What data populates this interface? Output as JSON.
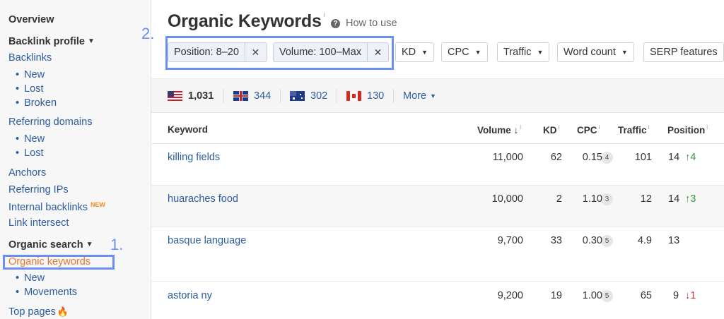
{
  "sidebar": {
    "overview": "Overview",
    "backlink_profile": "Backlink profile",
    "backlinks": "Backlinks",
    "backlinks_sub": [
      "New",
      "Lost",
      "Broken"
    ],
    "referring_domains": "Referring domains",
    "referring_domains_sub": [
      "New",
      "Lost"
    ],
    "anchors": "Anchors",
    "referring_ips": "Referring IPs",
    "internal_backlinks": "Internal backlinks",
    "new_badge": "NEW",
    "link_intersect": "Link intersect",
    "organic_search": "Organic search",
    "organic_keywords": "Organic keywords",
    "organic_sub": [
      "New",
      "Movements"
    ],
    "top_pages": "Top pages"
  },
  "annotations": {
    "step1": "1.",
    "step2": "2."
  },
  "page": {
    "title": "Organic Keywords",
    "title_info": "i",
    "how_to_use": "How to use"
  },
  "filters": {
    "active": [
      "Position: 8–20",
      "Volume: 100–Max"
    ],
    "dropdowns": [
      "KD",
      "CPC",
      "Traffic",
      "Word count",
      "SERP features"
    ]
  },
  "countries": [
    {
      "code": "US",
      "count": "1,031"
    },
    {
      "code": "GB",
      "count": "344"
    },
    {
      "code": "AU",
      "count": "302"
    },
    {
      "code": "CA",
      "count": "130"
    }
  ],
  "more_label": "More",
  "table": {
    "headers": [
      "Keyword",
      "Volume",
      "KD",
      "CPC",
      "Traffic",
      "Position"
    ],
    "rows": [
      {
        "keyword": "killing fields",
        "words": "4",
        "volume": "11,000",
        "kd": "62",
        "cpc": "0.15",
        "traffic": "101",
        "position": "14",
        "change": "↑4",
        "dir": "up"
      },
      {
        "keyword": "huaraches food",
        "words": "3",
        "volume": "10,000",
        "kd": "2",
        "cpc": "1.10",
        "traffic": "12",
        "position": "14",
        "change": "↑3",
        "dir": "up"
      },
      {
        "keyword": "basque language",
        "words": "5",
        "volume": "9,700",
        "kd": "33",
        "cpc": "0.30",
        "traffic": "4.9",
        "position": "13",
        "change": "",
        "dir": "none"
      },
      {
        "keyword": "astoria ny",
        "words": "5",
        "volume": "9,200",
        "kd": "19",
        "cpc": "1.00",
        "traffic": "65",
        "position": "9",
        "change": "↓1",
        "dir": "down"
      }
    ]
  },
  "colors": {
    "link": "#2b5c9f",
    "accent": "#e8772e",
    "annotation": "#6b8ef2",
    "up": "#3a9a3a",
    "down": "#d23a3a"
  }
}
